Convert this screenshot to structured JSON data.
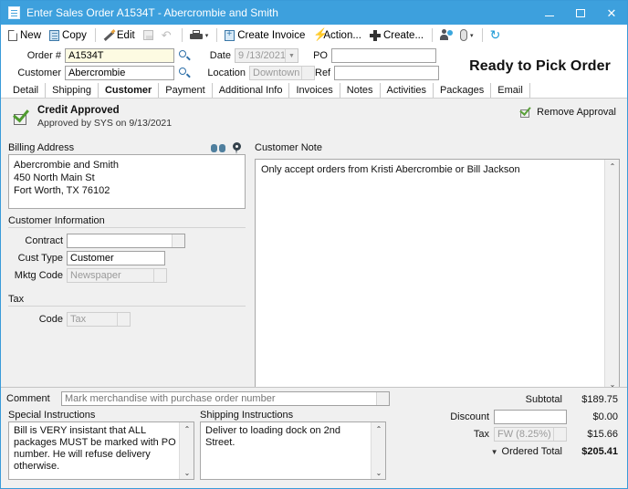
{
  "window": {
    "title": "Enter Sales Order A1534T - Abercrombie and Smith",
    "icon": "document-icon",
    "minimize": "–",
    "maximize": "□",
    "close": "✕",
    "accent_color": "#3da0dd"
  },
  "toolbar": {
    "items": [
      {
        "label": "New",
        "icon": "new-page-icon"
      },
      {
        "label": "Copy",
        "icon": "copy-icon"
      },
      {
        "label": "Edit",
        "icon": "pencil-icon"
      },
      {
        "label": "",
        "icon": "save-icon"
      },
      {
        "label": "",
        "icon": "undo-icon"
      },
      {
        "label": "",
        "icon": "print-icon"
      },
      {
        "label": "Create Invoice",
        "icon": "create-invoice-icon"
      },
      {
        "label": "Action...",
        "icon": "lightning-bolt-icon"
      },
      {
        "label": "Create...",
        "icon": "plus-icon"
      },
      {
        "label": "",
        "icon": "person-add-icon"
      },
      {
        "label": "",
        "icon": "paperclip-icon"
      },
      {
        "label": "",
        "icon": "refresh-icon"
      }
    ],
    "dropdown_caret": "▾"
  },
  "header": {
    "order_label": "Order #",
    "order_value": "A1534T",
    "customer_label": "Customer",
    "customer_value": "Abercrombie",
    "date_label": "Date",
    "date_value": "9 /13/2021",
    "location_label": "Location",
    "location_value": "Downtown",
    "po_label": "PO",
    "po_value": "",
    "ref_label": "Ref",
    "ref_value": "",
    "status_badge": "Ready to Pick Order"
  },
  "tabs": [
    {
      "label": "Detail",
      "active": false
    },
    {
      "label": "Shipping",
      "active": false
    },
    {
      "label": "Customer",
      "active": true
    },
    {
      "label": "Payment",
      "active": false
    },
    {
      "label": "Additional Info",
      "active": false
    },
    {
      "label": "Invoices",
      "active": false
    },
    {
      "label": "Notes",
      "active": false
    },
    {
      "label": "Activities",
      "active": false
    },
    {
      "label": "Packages",
      "active": false
    },
    {
      "label": "Email",
      "active": false
    }
  ],
  "credit": {
    "title": "Credit Approved",
    "subtitle": "Approved by SYS on 9/13/2021",
    "remove_label": "Remove Approval"
  },
  "billing": {
    "group_title": "Billing Address",
    "lines": [
      "Abercrombie and Smith",
      "450 North Main St",
      "Fort Worth, TX 76102"
    ]
  },
  "customer_information": {
    "group_title": "Customer Information",
    "contract_label": "Contract",
    "contract_value": "",
    "cust_type_label": "Cust Type",
    "cust_type_value": "Customer",
    "mktg_code_label": "Mktg Code",
    "mktg_code_value": "Newspaper"
  },
  "tax_section": {
    "group_title": "Tax",
    "code_label": "Code",
    "code_value": "Tax"
  },
  "customer_note": {
    "group_title": "Customer Note",
    "text": "Only accept orders from Kristi Abercrombie or Bill Jackson",
    "scroll_up": "⌃",
    "scroll_down": "⌄"
  },
  "comment": {
    "label": "Comment",
    "placeholder": "Mark merchandise with purchase order number",
    "value": ""
  },
  "special_instructions": {
    "label": "Special Instructions",
    "text": "Bill is VERY insistant that ALL packages MUST be marked with PO number.  He will refuse delivery otherwise."
  },
  "shipping_instructions": {
    "label": "Shipping Instructions",
    "text": "Deliver to loading dock on 2nd Street."
  },
  "totals": {
    "subtotal_label": "Subtotal",
    "subtotal_value": "$189.75",
    "discount_label": "Discount",
    "discount_input": "",
    "discount_value": "$0.00",
    "tax_label": "Tax",
    "tax_input": "FW (8.25%)",
    "tax_value": "$15.66",
    "ordered_total_label": "Ordered Total",
    "ordered_total_value": "$205.41",
    "expand_caret": "▼"
  }
}
